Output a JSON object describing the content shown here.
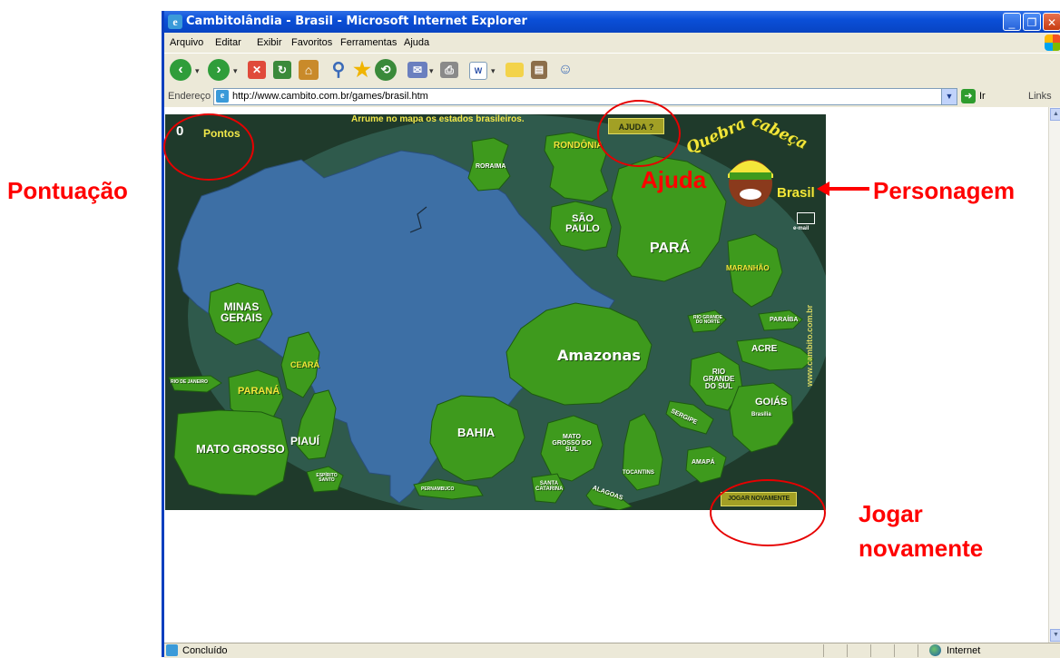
{
  "annotations": {
    "score": "Pontuação",
    "help": "Ajuda",
    "character": "Personagem",
    "replay_line1": "Jogar",
    "replay_line2": "novamente"
  },
  "window": {
    "title": "Cambitolândia - Brasil - Microsoft Internet Explorer",
    "buttons": [
      "minimize-icon",
      "maximize-icon",
      "close-icon"
    ]
  },
  "menu": [
    "Arquivo",
    "Editar",
    "Exibir",
    "Favoritos",
    "Ferramentas",
    "Ajuda"
  ],
  "address": {
    "label": "Endereço",
    "url": "http://www.cambito.com.br/games/brasil.htm",
    "go": "Ir",
    "links": "Links"
  },
  "status": {
    "text": "Concluído",
    "zone": "Internet"
  },
  "game": {
    "instruction": "Arrume no mapa  os estados brasileiros.",
    "score_value": "0",
    "score_label": "Pontos",
    "help_button": "AJUDA ?",
    "replay_button": "JOGAR NOVAMENTE",
    "logo_line1": "Quebra",
    "logo_line2": "cabeça",
    "logo_line3": "Brasil",
    "email": "e-mail",
    "site": "www.cambito.com.br",
    "pieces": {
      "roraima": "RORAIMA",
      "rondonia": "RONDÔNIA",
      "sao_paulo": "SÃO PAULO",
      "para": "PARÁ",
      "maranhao": "MARANHÃO",
      "minas": "MINAS GERAIS",
      "rio_norte": "RIO GRANDE DO NORTE",
      "paraiba": "PARAÍBA",
      "ceara": "CEARÁ",
      "amazonas": "Amazonas",
      "acre": "ACRE",
      "rio_sul": "RIO GRANDE DO SUL",
      "rio_janeiro": "RIO DE JANEIRO",
      "parana": "PARANÁ",
      "goias": "GOIÁS",
      "brasilia": "Brasília",
      "sergipe": "SERGIPE",
      "mato_grosso": "MATO GROSSO",
      "piaui": "PIAUÍ",
      "bahia": "BAHIA",
      "mato_grosso_sul": "MATO GROSSO DO SUL",
      "amapa": "AMAPÁ",
      "tocantins": "TOCANTINS",
      "espirito": "ESPÍRITO SANTO",
      "pernambuco": "PERNAMBUCO",
      "santa_catarina": "SANTA CATARINA",
      "alagoas": "ALAGOAS"
    }
  }
}
